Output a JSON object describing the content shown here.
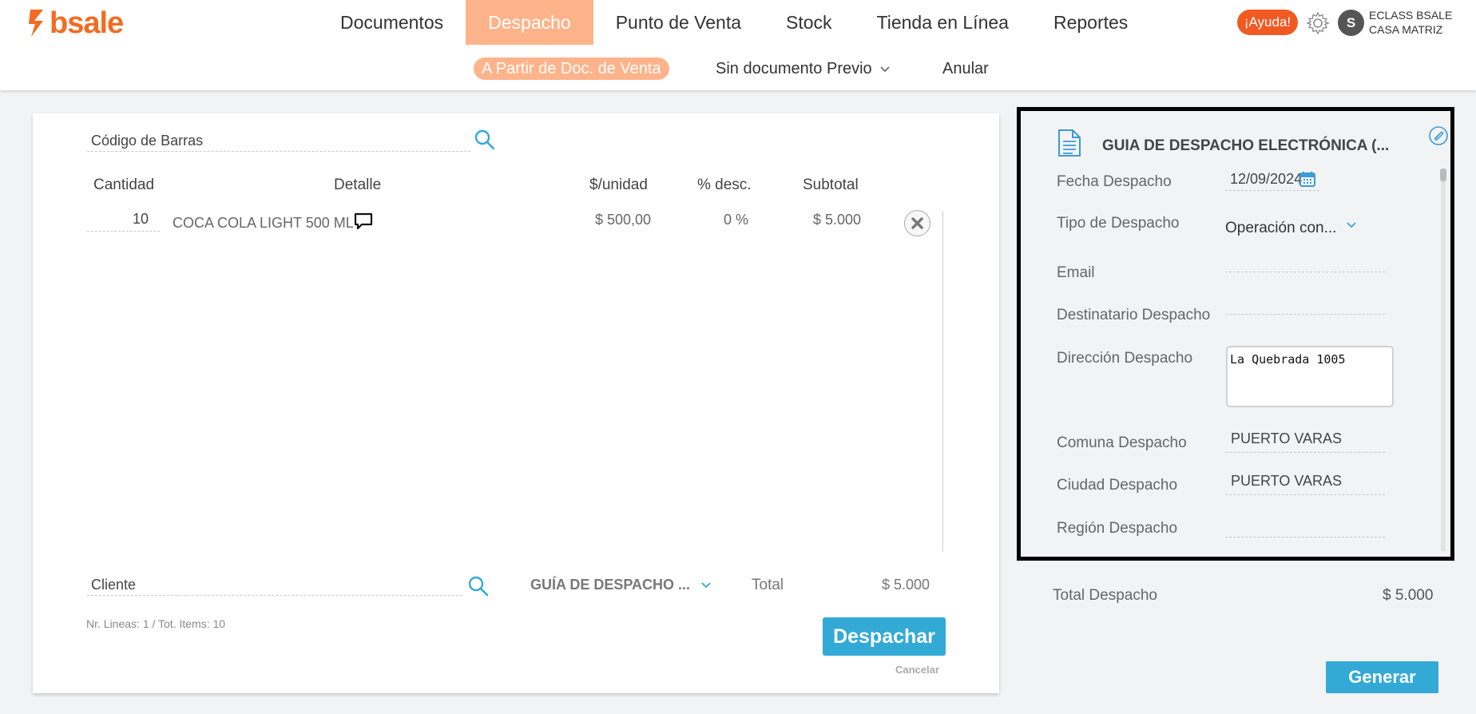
{
  "brand": {
    "name": "bsale",
    "color": "#f26b21"
  },
  "nav": {
    "items": [
      "Documentos",
      "Despacho",
      "Punto de Venta",
      "Stock",
      "Tienda en Línea",
      "Reportes"
    ],
    "active_index": 1,
    "active_color": "#ffb38a"
  },
  "header": {
    "help_label": "¡Ayuda!",
    "avatar_initial": "S",
    "company_line1": "ECLASS BSALE",
    "company_line2": "CASA MATRIZ"
  },
  "subnav": {
    "active": "A Partir de Doc. de Venta",
    "sin_doc": "Sin documento Previo",
    "anular": "Anular"
  },
  "left": {
    "barcode_placeholder": "Código de Barras",
    "columns": {
      "cantidad": "Cantidad",
      "detalle": "Detalle",
      "unidad": "$/unidad",
      "desc": "% desc.",
      "subtotal": "Subtotal"
    },
    "rows": [
      {
        "cantidad": "10",
        "detalle": "COCA COLA LIGHT 500 ML",
        "unidad": "$ 500,00",
        "desc": "0 %",
        "subtotal": "$ 5.000"
      }
    ],
    "cliente_placeholder": "Cliente",
    "doc_type": "GUÍA DE DESPACHO ...",
    "total_label": "Total",
    "total_value": "$ 5.000",
    "lines_info": "Nr. Lineas: 1 / Tot. Items: 10",
    "despachar_label": "Despachar",
    "cancelar_label": "Cancelar"
  },
  "right": {
    "doc_title": "GUIA DE DESPACHO ELECTRÓNICA (...",
    "fecha_label": "Fecha Despacho",
    "fecha_value": "12/09/2024",
    "tipo_label": "Tipo de Despacho",
    "tipo_value": "Operación con...",
    "email_label": "Email",
    "email_value": "",
    "destinatario_label": "Destinatario Despacho",
    "destinatario_value": "",
    "direccion_label": "Dirección Despacho",
    "direccion_value": "La Quebrada 1005",
    "comuna_label": "Comuna Despacho",
    "comuna_value": "PUERTO VARAS",
    "ciudad_label": "Ciudad Despacho",
    "ciudad_value": "PUERTO VARAS",
    "region_label": "Región Despacho",
    "region_value": "",
    "total_label": "Total Despacho",
    "total_value": "$ 5.000",
    "generar_label": "Generar"
  },
  "colors": {
    "accent": "#33a9d6",
    "help": "#f15a22"
  }
}
